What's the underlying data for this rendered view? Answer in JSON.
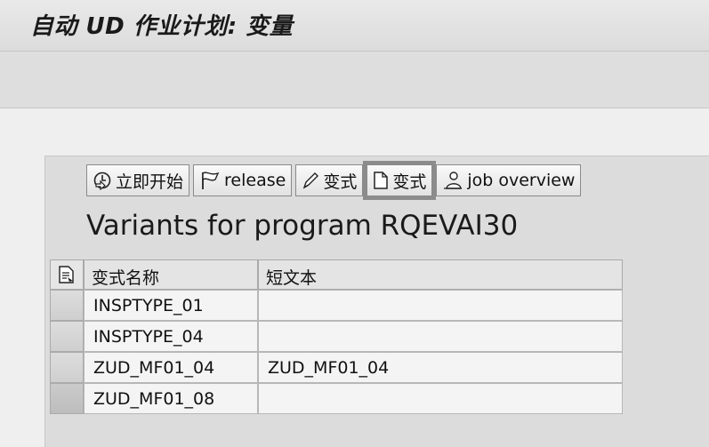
{
  "window": {
    "title": "自动 UD 作业计划: 变量"
  },
  "toolbar": {
    "start_label": "立即开始",
    "release_label": "release",
    "change_variant_label": "变式",
    "create_variant_label": "变式",
    "job_overview_label": "job overview"
  },
  "main": {
    "heading": "Variants for program RQEVAI30",
    "table": {
      "columns": [
        "变式名称",
        "短文本"
      ],
      "rows": [
        {
          "name": "INSPTYPE_01",
          "text": ""
        },
        {
          "name": "INSPTYPE_04",
          "text": ""
        },
        {
          "name": "ZUD_MF01_04",
          "text": "ZUD_MF01_04"
        },
        {
          "name": "ZUD_MF01_08",
          "text": ""
        }
      ]
    }
  },
  "icons": {
    "start": "execute-clock-icon",
    "release": "flag-icon",
    "change": "pencil-icon",
    "create": "new-document-icon",
    "job_overview": "person-icon",
    "table_settings": "table-settings-icon"
  }
}
